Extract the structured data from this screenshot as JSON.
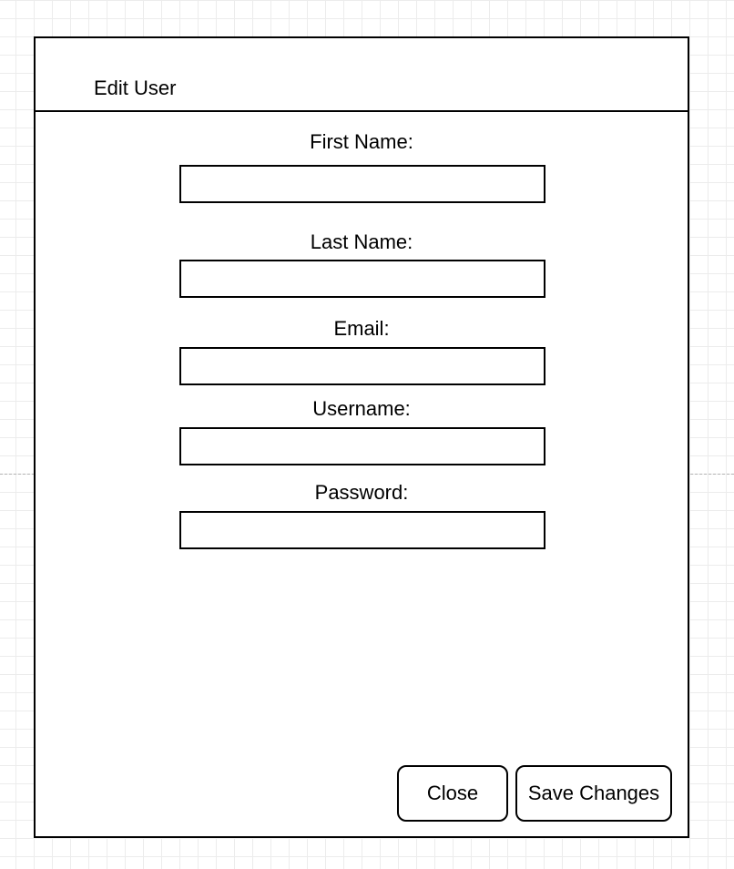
{
  "dialog": {
    "title": "Edit User"
  },
  "form": {
    "fields": [
      {
        "label": "First Name:",
        "value": ""
      },
      {
        "label": "Last Name:",
        "value": ""
      },
      {
        "label": "Email:",
        "value": ""
      },
      {
        "label": "Username:",
        "value": ""
      },
      {
        "label": "Password:",
        "value": ""
      }
    ]
  },
  "actions": {
    "close_label": "Close",
    "save_label": "Save Changes"
  }
}
